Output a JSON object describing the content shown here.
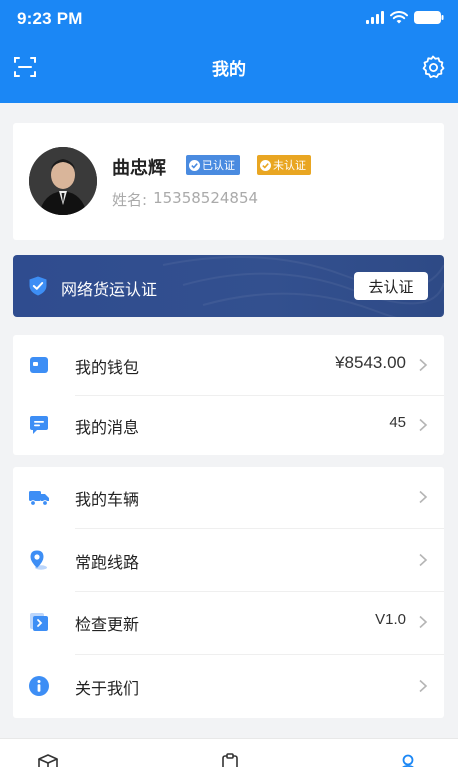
{
  "status_bar": {
    "time": "9:23 PM"
  },
  "header": {
    "title": "我的",
    "scan_icon": "scan-icon",
    "settings_icon": "gear-icon"
  },
  "profile": {
    "name": "曲忠辉",
    "badge_verified": "已认证",
    "badge_unverified": "未认证",
    "phone_label": "姓名:",
    "phone": "15358524854"
  },
  "banner": {
    "text": "网络货运认证",
    "button": "去认证",
    "icon": "shield-check-icon"
  },
  "menu": {
    "group1": [
      {
        "label": "我的钱包",
        "value": "¥8543.00",
        "icon": "wallet-icon"
      },
      {
        "label": "我的消息",
        "value": "45",
        "icon": "message-icon"
      }
    ],
    "group2": [
      {
        "label": "我的车辆",
        "value": "",
        "icon": "truck-icon"
      },
      {
        "label": "常跑线路",
        "value": "",
        "icon": "location-pin-icon"
      },
      {
        "label": "检查更新",
        "value": "V1.0",
        "icon": "update-icon"
      },
      {
        "label": "关于我们",
        "value": "",
        "icon": "info-icon"
      }
    ]
  },
  "tabbar": {
    "icons": [
      "package-icon",
      "clipboard-icon",
      "user-icon"
    ]
  },
  "colors": {
    "brand": "#1b87f5",
    "verified": "#4a8be0",
    "unverified": "#e9a622",
    "banner": "#2f4c8f"
  }
}
